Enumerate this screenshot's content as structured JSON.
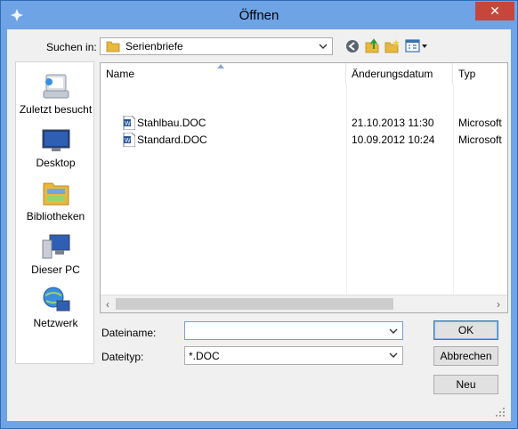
{
  "window": {
    "title": "Öffnen",
    "close_label": "✕"
  },
  "lookin": {
    "label": "Suchen in:",
    "value": "Serienbriefe"
  },
  "toolbar": {
    "icons": [
      "back-icon",
      "up-folder-icon",
      "new-folder-icon",
      "view-menu-icon"
    ]
  },
  "places": [
    {
      "label": "Zuletzt besucht",
      "icon": "recent-places-icon"
    },
    {
      "label": "Desktop",
      "icon": "desktop-icon"
    },
    {
      "label": "Bibliotheken",
      "icon": "libraries-icon"
    },
    {
      "label": "Dieser PC",
      "icon": "this-pc-icon"
    },
    {
      "label": "Netzwerk",
      "icon": "network-icon"
    }
  ],
  "filelist": {
    "columns": [
      "Name",
      "Änderungsdatum",
      "Typ"
    ],
    "rows": [
      {
        "name": "Stahlbau.DOC",
        "date": "21.10.2013 11:30",
        "type": "Microsoft"
      },
      {
        "name": "Standard.DOC",
        "date": "10.09.2012 10:24",
        "type": "Microsoft"
      }
    ]
  },
  "form": {
    "filename_label": "Dateiname:",
    "filename_value": "",
    "filetype_label": "Dateityp:",
    "filetype_value": "*.DOC"
  },
  "buttons": {
    "ok": "OK",
    "cancel": "Abbrechen",
    "new": "Neu"
  },
  "colors": {
    "titlebar": "#6ea3e6",
    "close": "#c7463b",
    "accent": "#3c7fb1"
  }
}
